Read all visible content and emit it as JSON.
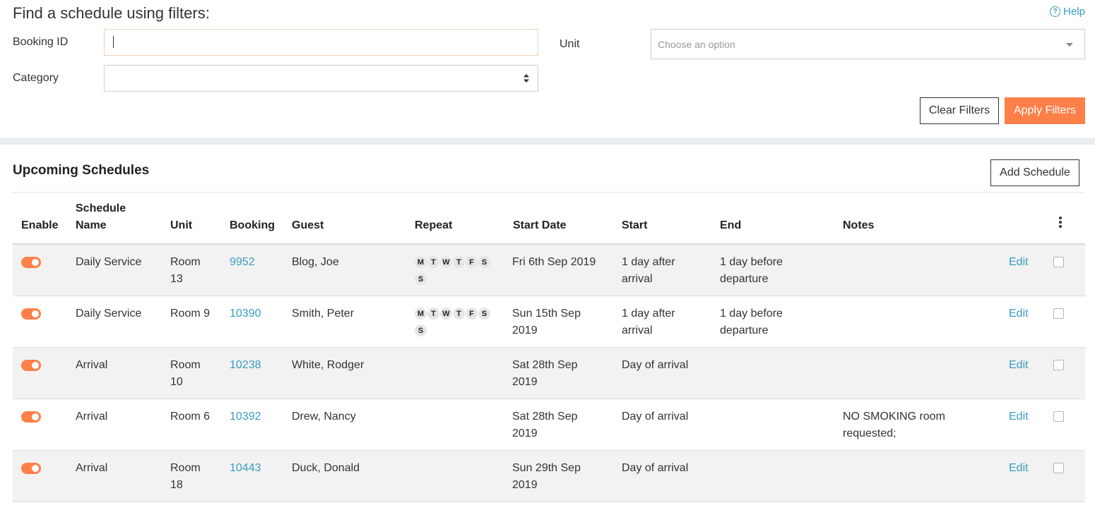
{
  "filters": {
    "title": "Find a schedule using filters:",
    "help_label": "Help",
    "booking_id_label": "Booking ID",
    "booking_id_value": "",
    "category_label": "Category",
    "category_value": "",
    "unit_label": "Unit",
    "unit_placeholder": "Choose an option",
    "clear_label": "Clear Filters",
    "apply_label": "Apply Filters"
  },
  "schedules": {
    "title": "Upcoming Schedules",
    "add_label": "Add Schedule",
    "headers": {
      "enable": "Enable",
      "schedule_name": "Schedule Name",
      "unit": "Unit",
      "booking": "Booking",
      "guest": "Guest",
      "repeat": "Repeat",
      "start_date": "Start Date",
      "start": "Start",
      "end": "End",
      "notes": "Notes"
    },
    "rows": [
      {
        "enabled": true,
        "name": "Daily Service",
        "unit": "Room 13",
        "booking": "9952",
        "guest": "Blog, Joe",
        "repeat": [
          "M",
          "T",
          "W",
          "T",
          "F",
          "S",
          "S"
        ],
        "start_date": "Fri 6th Sep 2019",
        "start": "1 day after arrival",
        "end": "1 day before departure",
        "notes": "",
        "edit": "Edit"
      },
      {
        "enabled": true,
        "name": "Daily Service",
        "unit": "Room 9",
        "booking": "10390",
        "guest": "Smith, Peter",
        "repeat": [
          "M",
          "T",
          "W",
          "T",
          "F",
          "S",
          "S"
        ],
        "start_date": "Sun 15th Sep 2019",
        "start": "1 day after arrival",
        "end": "1 day before departure",
        "notes": "",
        "edit": "Edit"
      },
      {
        "enabled": true,
        "name": "Arrival",
        "unit": "Room 10",
        "booking": "10238",
        "guest": "White, Rodger",
        "repeat": [],
        "start_date": "Sat 28th Sep 2019",
        "start": "Day of arrival",
        "end": "",
        "notes": "",
        "edit": "Edit"
      },
      {
        "enabled": true,
        "name": "Arrival",
        "unit": "Room 6",
        "booking": "10392",
        "guest": "Drew, Nancy",
        "repeat": [],
        "start_date": "Sat 28th Sep 2019",
        "start": "Day of arrival",
        "end": "",
        "notes": "NO SMOKING room requested;",
        "edit": "Edit"
      },
      {
        "enabled": true,
        "name": "Arrival",
        "unit": "Room 18",
        "booking": "10443",
        "guest": "Duck, Donald",
        "repeat": [],
        "start_date": "Sun 29th Sep 2019",
        "start": "Day of arrival",
        "end": "",
        "notes": "",
        "edit": "Edit"
      }
    ]
  },
  "colors": {
    "accent": "#ff7f48",
    "link": "#3a9cc0",
    "row_shade": "#f2f2f2"
  }
}
